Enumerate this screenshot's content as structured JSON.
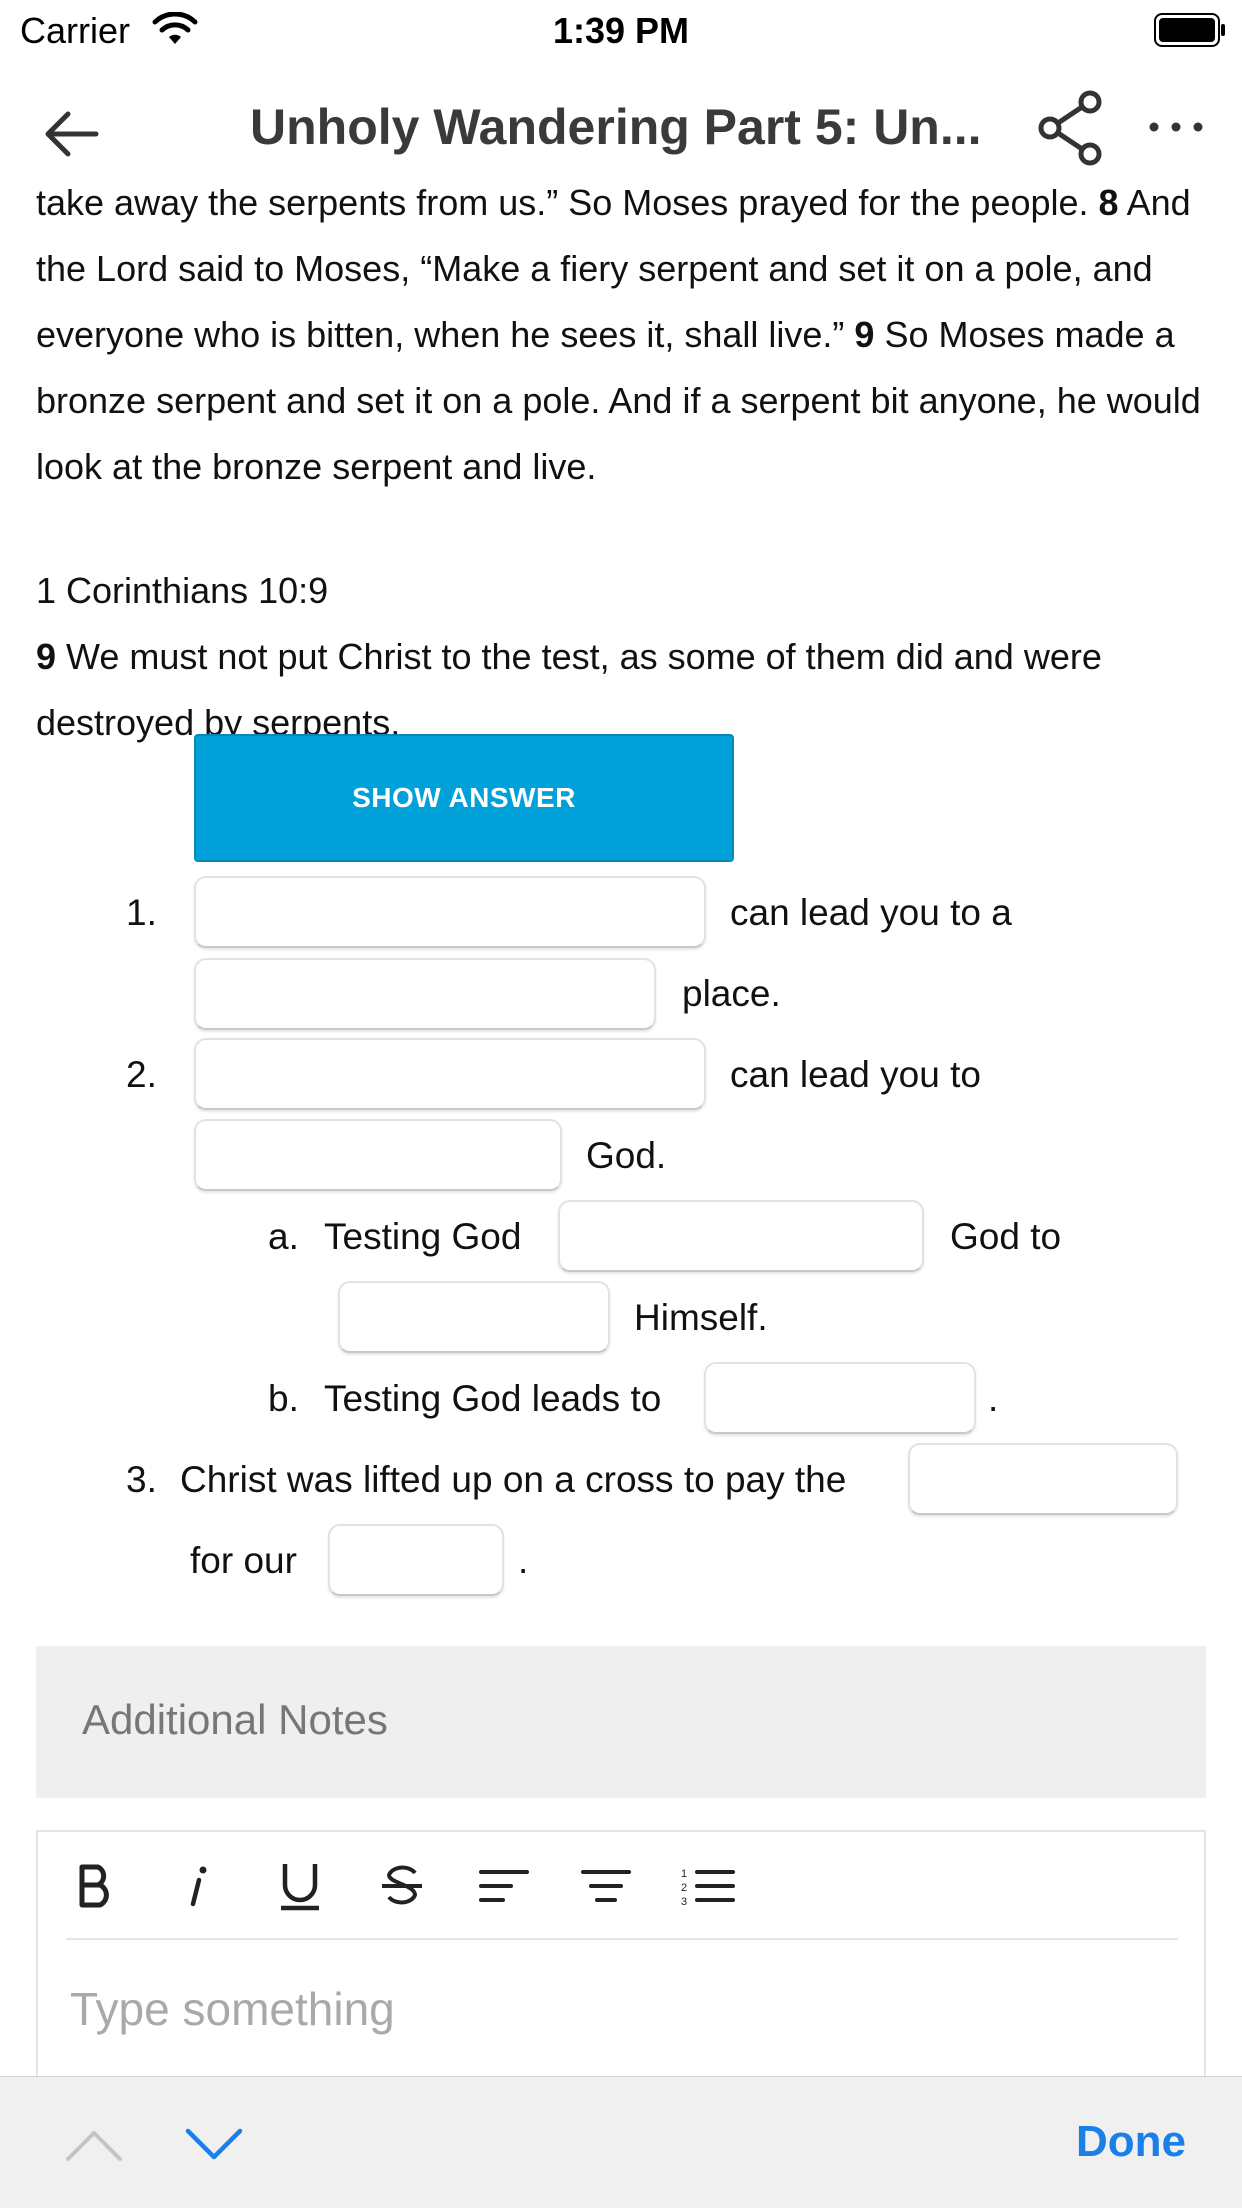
{
  "status_bar": {
    "carrier": "Carrier",
    "time": "1:39 PM"
  },
  "nav": {
    "title": "Unholy Wandering Part 5: Un..."
  },
  "scripture": {
    "p1": [
      {
        "text": "take away the serpents from us.” So Moses prayed for the people. "
      },
      {
        "text": "8",
        "bold": true
      },
      {
        "text": " And the Lord said to Moses, “Make a fiery serpent and set it on a pole, and everyone who is bitten, when he sees it, shall live.” "
      },
      {
        "text": "9",
        "bold": true
      },
      {
        "text": " So Moses made a bronze serpent and set it on a pole. And if a serpent bit anyone, he would look at the bronze serpent and live."
      }
    ],
    "ref_title": "1 Corinthians 10:9",
    "p2": [
      {
        "text": "9",
        "bold": true
      },
      {
        "text": " We must not put Christ to the test, as some of them did and were destroyed by serpents,"
      }
    ]
  },
  "show_answer_label": "SHOW ANSWER",
  "outline": {
    "item1": {
      "number": "1.",
      "text_a": "can lead you to a",
      "text_b": "place."
    },
    "item2": {
      "number": "2.",
      "text_a": "can lead you to",
      "text_b": "God."
    },
    "item2a": {
      "letter": "a.",
      "text_a": "Testing God",
      "text_b": "God to",
      "text_c": "Himself."
    },
    "item2b": {
      "letter": "b.",
      "text_a": "Testing God leads to",
      "text_b": "."
    },
    "item3": {
      "number": "3.",
      "text_a": "Christ was lifted up on a cross to pay the",
      "text_b": "for our",
      "text_c": "."
    }
  },
  "notes": {
    "label": "Additional Notes",
    "placeholder": "Type something",
    "toolbar": [
      "bold-icon",
      "italic-icon",
      "underline-icon",
      "strikethrough-icon",
      "align-left-icon",
      "align-center-icon",
      "numbered-list-icon"
    ]
  },
  "accessory_bar": {
    "done_label": "Done"
  },
  "colors": {
    "accent": "#00a1d8",
    "done": "#1a7fe8",
    "notes_bg": "#efefef"
  }
}
